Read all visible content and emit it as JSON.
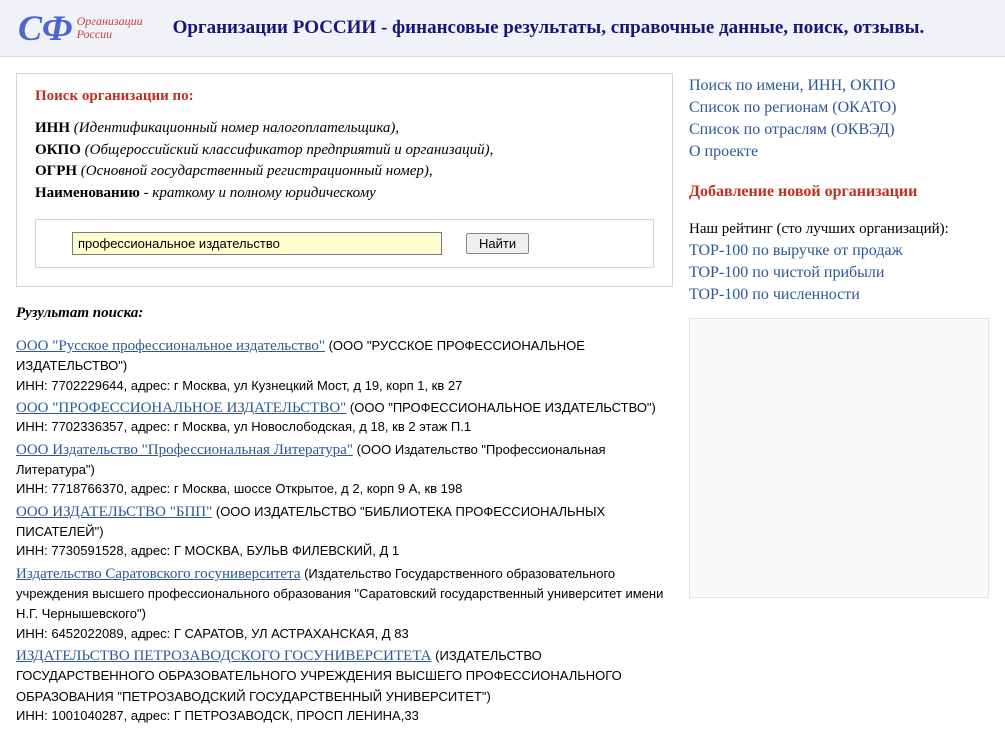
{
  "header": {
    "logo_cf": "СФ",
    "logo_line1": "Организации",
    "logo_line2": "России",
    "title": "Организации РОССИИ - финансовые результаты, справочные данные, поиск, отзывы."
  },
  "search": {
    "title": "Поиск организации по:",
    "fields": {
      "inn_b": "ИНН",
      "inn_i": "(Идентификационный номер налогоплательщика)",
      "inn_t": ",",
      "okpo_b": "ОКПО",
      "okpo_i": "(Общероссийский классификатор предприятий и организаций)",
      "okpo_t": ",",
      "ogrn_b": "ОГРН",
      "ogrn_i": "(Основной государственный регистрационный номер)",
      "ogrn_t": ",",
      "name_b": "Наименованию",
      "name_i": " - краткому и полному юридическому"
    },
    "input_value": "профессиональное издательство",
    "button": "Найти"
  },
  "results": {
    "title": "Рузультат поиска:",
    "items": [
      {
        "link": "ООО \"Русское профессиональное издательство\"",
        "full": " (ООО \"РУССКОЕ ПРОФЕССИОНАЛЬНОЕ ИЗДАТЕЛЬСТВО\")",
        "details": "ИНН: 7702229644, адрес: г Москва, ул Кузнецкий Мост, д 19, корп 1, кв 27"
      },
      {
        "link": "ООО \"ПРОФЕССИОНАЛЬНОЕ ИЗДАТЕЛЬСТВО\"",
        "full": " (ООО \"ПРОФЕССИОНАЛЬНОЕ ИЗДАТЕЛЬСТВО\")",
        "details": "ИНН: 7702336357, адрес: г Москва, ул Новослободская, д 18, кв 2 этаж П.1"
      },
      {
        "link": "ООО Издательство \"Профессиональная Литература\"",
        "full": " (ООО Издательство \"Профессиональная Литература\")",
        "details": "ИНН: 7718766370, адрес: г Москва, шоссе Открытое, д 2, корп 9 А, кв 198"
      },
      {
        "link": "ООО ИЗДАТЕЛЬСТВО \"БПП\"",
        "full": " (ООО ИЗДАТЕЛЬСТВО \"БИБЛИОТЕКА ПРОФЕССИОНАЛЬНЫХ ПИСАТЕЛЕЙ\")",
        "details": "ИНН: 7730591528, адрес: Г МОСКВА, БУЛЬВ ФИЛЕВСКИЙ, Д 1"
      },
      {
        "link": "Издательство Саратовского госуниверситета",
        "full": " (Издательство Государственного образовательного учреждения высшего профессионального образования \"Саратовский государственный университет имени Н.Г. Чернышевского\")",
        "details": "ИНН: 6452022089, адрес: Г САРАТОВ, УЛ АСТРАХАНСКАЯ, Д 83"
      },
      {
        "link": "ИЗДАТЕЛЬСТВО ПЕТРОЗАВОДСКОГО ГОСУНИВЕРСИТЕТА",
        "full": " (ИЗДАТЕЛЬСТВО ГОСУДАРСТВЕННОГО ОБРАЗОВАТЕЛЬНОГО УЧРЕЖДЕНИЯ ВЫСШЕГО ПРОФЕССИОНАЛЬНОГО ОБРАЗОВАНИЯ \"ПЕТРОЗАВОДСКИЙ ГОСУДАРСТВЕННЫЙ УНИВЕРСИТЕТ\")",
        "details": "ИНН: 1001040287, адрес: Г ПЕТРОЗАВОДСК, ПРОСП ЛЕНИНА,33"
      }
    ]
  },
  "nav": {
    "items": [
      "Поиск по имени, ИНН, ОКПО",
      "Список по регионам (ОКАТО)",
      "Список по отраслям (ОКВЭД)",
      "О проекте"
    ],
    "add": "Добавление новой организации",
    "rating_label": "Наш рейтинг (сто лучших организаций):",
    "tops": [
      "TOP-100 по выручке от продаж",
      "TOP-100 по чистой прибыли",
      "TOP-100 по численности"
    ]
  }
}
